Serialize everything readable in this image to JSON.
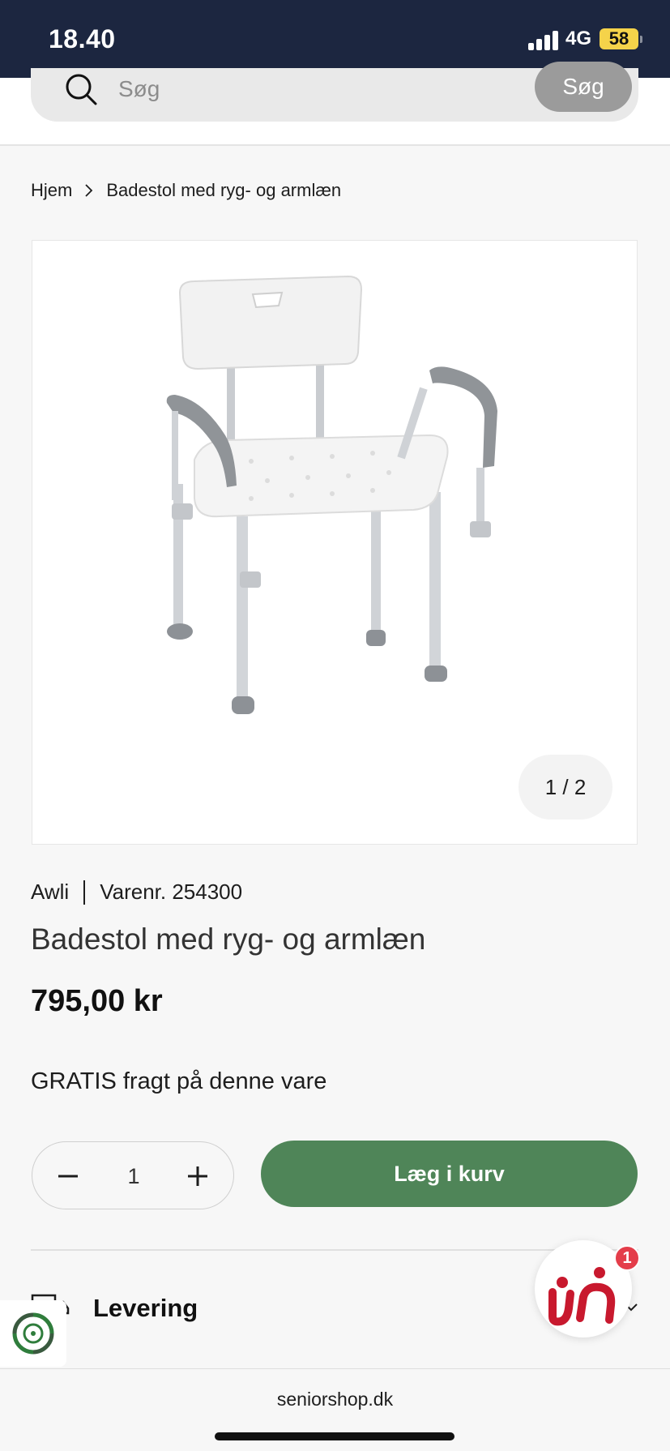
{
  "status_bar": {
    "time": "18.40",
    "network": "4G",
    "battery": "58"
  },
  "search": {
    "placeholder": "Søg",
    "button_label": "Søg"
  },
  "breadcrumb": {
    "home": "Hjem",
    "current": "Badestol med ryg- og armlæn"
  },
  "gallery": {
    "counter": "1 / 2",
    "image_alt": "Badestol med ryg- og armlæn"
  },
  "product": {
    "brand": "Awli",
    "sku_label": "Varenr. 254300",
    "title": "Badestol med ryg- og armlæn",
    "price": "795,00 kr",
    "shipping_note": "GRATIS fragt på denne vare"
  },
  "cart": {
    "quantity": "1",
    "add_label": "Læg i kurv"
  },
  "sections": {
    "delivery_label": "Levering"
  },
  "chat": {
    "badge_count": "1"
  },
  "browser": {
    "url": "seniorshop.dk"
  },
  "colors": {
    "header_bg": "#1c2640",
    "accent_green": "#4f8558",
    "chat_red": "#c8192e"
  }
}
